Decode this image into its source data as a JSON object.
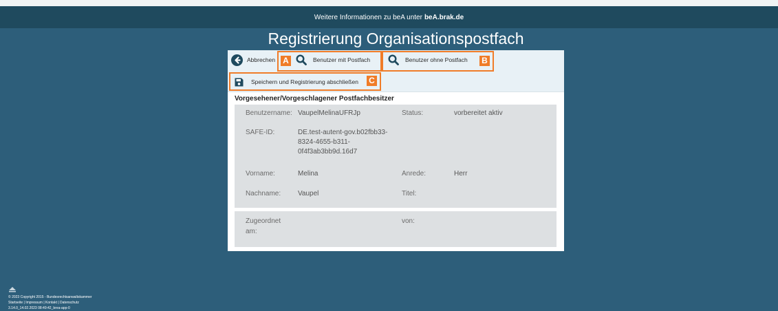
{
  "banner": {
    "prefix": "Weitere Informationen zu beA unter",
    "link": "beA.brak.de"
  },
  "page_title": "Registrierung Organisationspostfach",
  "toolbar": {
    "cancel_label": "Abbrechen",
    "users_with_mailbox_label": "Benutzer mit Postfach",
    "users_without_mailbox_label": "Benutzer ohne Postfach",
    "save_label": "Speichern und Registrierung abschließen",
    "markers": [
      "A",
      "B",
      "C"
    ]
  },
  "section_heading": "Vorgesehener/Vorgeschlagener Postfachbesitzer",
  "details": {
    "username_label": "Benutzername:",
    "username_value": "VaupelMelinaUFRJp",
    "status_label": "Status:",
    "status_value": "vorbereitet aktiv",
    "safe_id_label": "SAFE-ID:",
    "safe_id_lines": [
      "DE.test-autent-gov.b02fbb33-",
      "8324-4655-b311-",
      "0f4f3ab3bb9d.16d7"
    ],
    "firstname_label": "Vorname:",
    "firstname_value": "Melina",
    "salutation_label": "Anrede:",
    "salutation_value": "Herr",
    "lastname_label": "Nachname:",
    "lastname_value": "Vaupel",
    "title_label": "Titel:"
  },
  "assignment": {
    "assigned_label_lines": [
      "Zugeordnet",
      "am:"
    ],
    "by_label": "von:"
  },
  "footer": {
    "copyright": "© 2023 Copyright 2015 - Bundesrechtsanwaltskammer",
    "links": "Startseite | Impressum | Kontakt | Datenschutz",
    "version": "3.14.0_14.02.2023 08:49:42_brea-app-0"
  },
  "colors": {
    "background": "#2d5e7a",
    "banner": "#1f4a5e",
    "highlight": "#f07c28",
    "icon": "#1f4a5e"
  }
}
